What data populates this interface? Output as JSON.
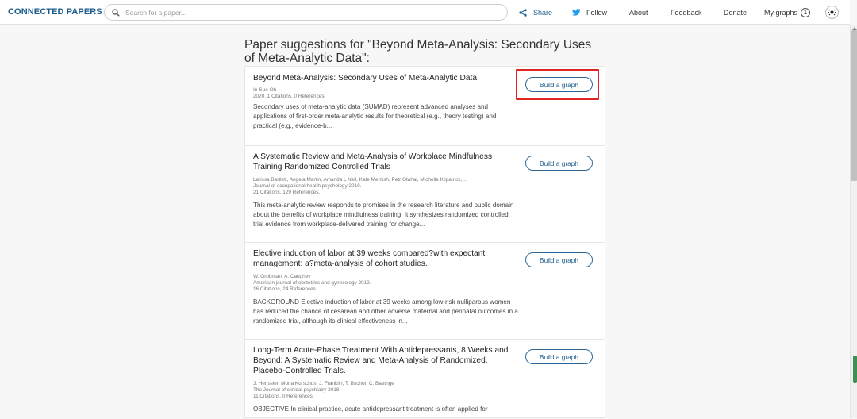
{
  "header": {
    "logo": "CONNECTED PAPERS",
    "search_placeholder": "Search for a paper...",
    "share": "Share",
    "follow": "Follow",
    "about": "About",
    "feedback": "Feedback",
    "donate": "Donate",
    "my_graphs": "My graphs",
    "my_graphs_count": "1"
  },
  "heading": "Paper suggestions for \"Beyond Meta-Analysis: Secondary Uses of Meta-Analytic Data\":",
  "papers": [
    {
      "title": "Beyond Meta-Analysis: Secondary Uses of Meta-Analytic Data",
      "authors": "In-Sue Oh",
      "journal": "",
      "stats": "2020. 1 Citations, 0 References.",
      "abstract": "Secondary uses of meta-analytic data (SUMAD) represent advanced analyses and applications of first-order meta-analytic results for theoretical (e.g., theory testing) and practical (e.g., evidence-b...",
      "button": "Build a graph"
    },
    {
      "title": "A Systematic Review and Meta-Analysis of Workplace Mindfulness Training Randomized Controlled Trials",
      "authors": "Larissa Bartlett, Angela Martin, Amanda L Neil, Kate Memish, Petr Otahal, Michelle Kilpatrick, ...",
      "journal": "Journal of occupational health psychology 2019.",
      "stats": "21 Citations, 129 References.",
      "abstract": "This meta-analytic review responds to promises in the research literature and public domain about the benefits of workplace mindfulness training. It synthesizes randomized controlled trial evidence from workplace-delivered training for change...",
      "button": "Build a graph"
    },
    {
      "title": "Elective induction of labor at 39 weeks compared?with expectant management: a?meta-analysis of cohort studies.",
      "authors": "W. Grobman, A. Caughey",
      "journal": "American journal of obstetrics and gynecology 2019.",
      "stats": "16 Citations, 24 References.",
      "abstract": "BACKGROUND Elective induction of labor at 39 weeks among low-risk nulliparous women has reduced the chance of cesarean and other adverse maternal and perinatal outcomes in a randomized trial, although its clinical effectiveness in...",
      "button": "Build a graph"
    },
    {
      "title": "Long-Term Acute-Phase Treatment With Antidepressants, 8 Weeks and Beyond: A Systematic Review and Meta-Analysis of Randomized, Placebo-Controlled Trials.",
      "authors": "J. Henssler, Mona Kurschus, J. Franklin, T. Bschor, C. Baethge",
      "journal": "The Journal of clinical psychiatry 2018.",
      "stats": "11 Citations, 0 References.",
      "abstract": "OBJECTIVE In clinical practice, acute antidepressant treatment is often applied for",
      "button": "Build a graph"
    }
  ]
}
